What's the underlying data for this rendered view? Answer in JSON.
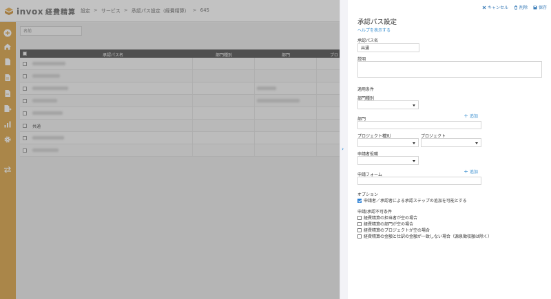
{
  "app": {
    "logo_text": "invox",
    "logo_sub": "経費精算"
  },
  "breadcrumb": [
    "設定",
    "サービス",
    "承認パス設定（経費精算）",
    "645"
  ],
  "breadcrumb_sep": ">",
  "list": {
    "search_placeholder": "名前",
    "columns": [
      "承認パス名",
      "部門種別",
      "部門",
      "プロ"
    ],
    "rows": [
      {
        "name": "",
        "blurred": true,
        "dept_blur": false
      },
      {
        "name": "",
        "blurred": true,
        "dept_blur": false
      },
      {
        "name": "",
        "blurred": true,
        "dept_blur": true
      },
      {
        "name": "",
        "blurred": true,
        "dept_blur": true
      },
      {
        "name": "",
        "blurred": true,
        "dept_blur": false
      },
      {
        "name": "共通",
        "blurred": false,
        "dept_blur": false
      },
      {
        "name": "",
        "blurred": true,
        "dept_blur": false
      },
      {
        "name": "",
        "blurred": true,
        "dept_blur": false
      }
    ]
  },
  "panel": {
    "actions": {
      "cancel": "キャンセル",
      "delete": "削除",
      "save": "保存"
    },
    "title": "承認パス設定",
    "help": "ヘルプを表示する",
    "name_label": "承認パス名",
    "name_value": "共通",
    "desc_label": "説明",
    "desc_value": "",
    "conditions_label": "適用条件",
    "dept_type_label": "部門種別",
    "dept_label": "部門",
    "add_label": "追加",
    "project_type_label": "プロジェクト種別",
    "project_label": "プロジェクト",
    "applicant_role_label": "申請者役職",
    "form_label": "申請フォーム",
    "options_label": "オプション",
    "option_item": "申請者／承認者による承認ステップの追加を可能とする",
    "option_checked": true,
    "deny_label": "申請/承認不可条件",
    "deny_items": [
      "経費精算の担当者が空の場合",
      "経費精算の部門が空の場合",
      "経費精算のプロジェクトが空の場合",
      "経費精算の金額と仕訳の金額が一致しない場合（源泉徴収額は除く）"
    ]
  },
  "colors": {
    "sidebar": "#d6982f",
    "accent": "#2a7fd4",
    "header_dark": "#3a3a3a"
  }
}
